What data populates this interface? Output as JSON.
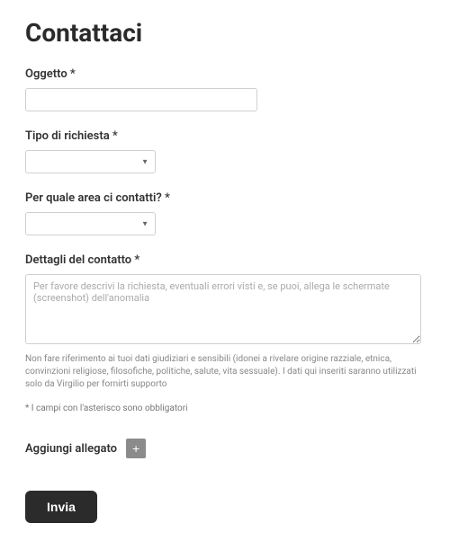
{
  "title": "Contattaci",
  "fields": {
    "subject": {
      "label": "Oggetto *",
      "value": ""
    },
    "requestType": {
      "label": "Tipo di richiesta *",
      "value": ""
    },
    "area": {
      "label": "Per quale area ci contatti? *",
      "value": ""
    },
    "details": {
      "label": "Dettagli del contatto *",
      "placeholder": "Per favore descrivi la richiesta, eventuali errori visti e, se puoi, allega le schermate (screenshot) dell'anomalia",
      "value": "",
      "hint": "Non fare riferimento ai tuoi dati giudiziari e sensibili (idonei a rivelare origine razziale, etnica, convinzioni religiose, filosofiche, politiche, salute, vita sessuale). I dati qui inseriti saranno utilizzati solo da Virgilio per fornirti supporto"
    }
  },
  "requiredNote": "* I campi con l'asterisco sono obbligatori",
  "attachment": {
    "label": "Aggiungi allegato",
    "buttonLabel": "+"
  },
  "submit": {
    "label": "Invia"
  }
}
